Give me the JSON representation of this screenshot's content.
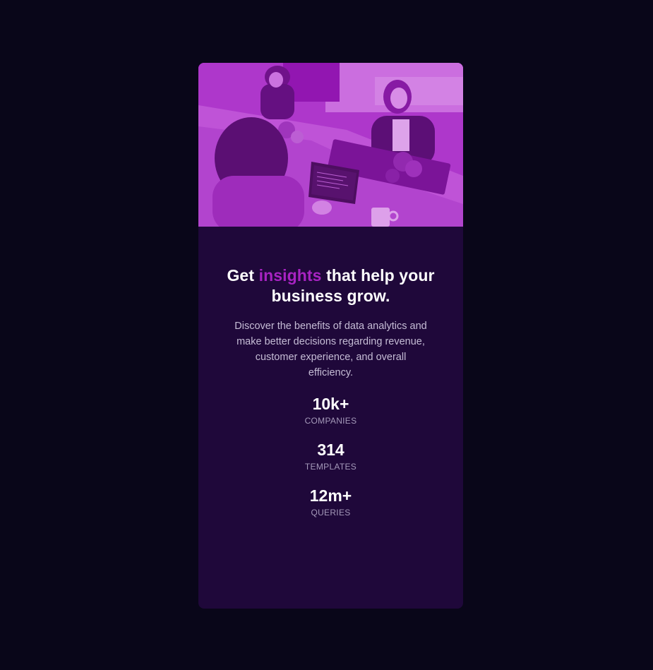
{
  "card": {
    "image_alt": "people working at office desks",
    "title_prefix": "Get",
    "title_accent": "insights",
    "title_suffix": "that help your business grow.",
    "description": "Discover the benefits of data analytics and make better decisions regarding revenue, customer experience, and overall efficiency.",
    "stats": [
      {
        "value": "10k+",
        "label": "COMPANIES"
      },
      {
        "value": "314",
        "label": "TEMPLATES"
      },
      {
        "value": "12m+",
        "label": "QUERIES"
      }
    ]
  },
  "colors": {
    "page_background": "#090619",
    "card_background": "#1f083a",
    "accent": "#a823c2",
    "image_tint": "#a21bbd",
    "heading": "#ffffff",
    "body_text": "#c5bcd5",
    "stat_label": "#a59aba"
  }
}
